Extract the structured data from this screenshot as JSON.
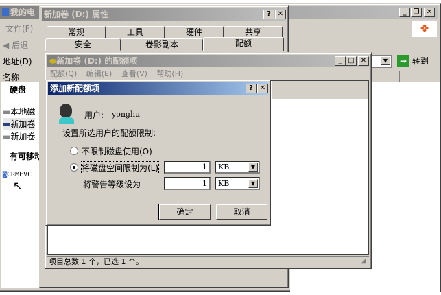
{
  "explorer": {
    "title": "我的电",
    "menu_file": "文件(F)",
    "back": "后退",
    "address_label": "地址(D)",
    "go": "转到",
    "column_name": "名称",
    "sections": {
      "hard_disks": "硬盘",
      "removable": "有可移动"
    },
    "items": [
      "本地磁",
      "新加卷",
      "新加卷"
    ],
    "cd_item": "CRMEVC"
  },
  "properties": {
    "title": "新加卷 (D:) 属性",
    "tabs_row1": [
      "常规",
      "工具",
      "硬件",
      "共享"
    ],
    "tabs_row2": [
      "安全",
      "卷影副本",
      "配额"
    ],
    "active_tab": "配额"
  },
  "quota_window": {
    "title": "新加卷 (D:) 的配额项",
    "menu": [
      "配额(Q)",
      "编辑(E)",
      "查看(V)",
      "帮助(H)"
    ],
    "status": "项目总数 1 个，已选 1 个。"
  },
  "dialog": {
    "title": "添加新配额项",
    "user_label": "用户:",
    "user_name": "yonghu",
    "prompt": "设置所选用户的配额限制:",
    "option_no_limit": "不限制磁盘使用(O)",
    "option_limit": "将磁盘空间限制为(L)",
    "warning_label": "将警告等级设为",
    "limit_value": "1",
    "limit_unit": "KB",
    "warning_value": "1",
    "warning_unit": "KB",
    "selected_option": "limit",
    "ok": "确定",
    "cancel": "取消"
  }
}
